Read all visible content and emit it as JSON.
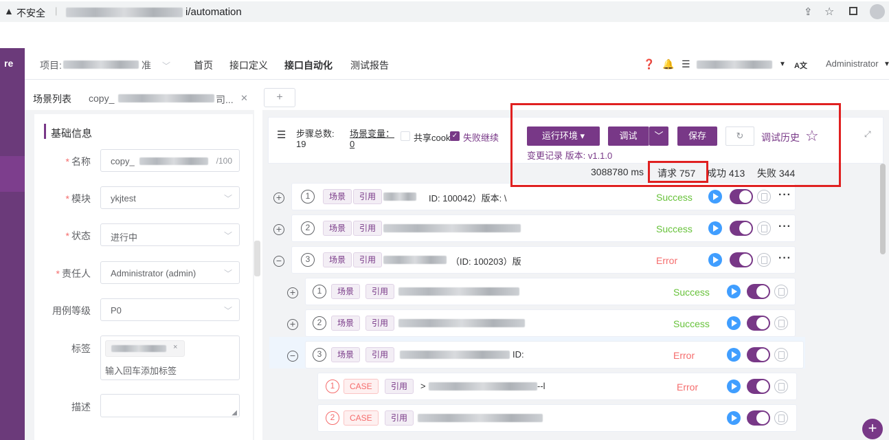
{
  "browser": {
    "security_label": "不安全",
    "url_suffix": "i/automation"
  },
  "app": {
    "brand": "re",
    "project_label": "项目:",
    "project_suffix": "准",
    "nav": [
      "首页",
      "接口定义",
      "接口自动化",
      "测试报告"
    ],
    "user": "Administrator",
    "lang_icon": "A文"
  },
  "tabs": {
    "scene_list": "场景列表",
    "current_tab": "copy_",
    "current_tab_suffix": "司...",
    "add": "+"
  },
  "form": {
    "section_title": "基础信息",
    "name_label": "名称",
    "name_value": "copy_",
    "name_counter": "/100",
    "module_label": "模块",
    "module_value": "ykjtest",
    "status_label": "状态",
    "status_value": "进行中",
    "owner_label": "责任人",
    "owner_value": "Administrator (admin)",
    "level_label": "用例等级",
    "level_value": "P0",
    "tag_label": "标签",
    "tag_placeholder": "输入回车添加标签",
    "desc_label": "描述"
  },
  "toolbar": {
    "steps_label": "步骤总数:",
    "steps_value": "19",
    "vars_label": "场景变量：",
    "vars_value": "0",
    "share_cookie": "共享cook",
    "fail_continue": "失败继续",
    "env_button": "运行环境",
    "debug_button": "调试",
    "save_button": "保存",
    "history": "调试历史",
    "change_record": "变更记录 版本: v1.1.0",
    "duration": "3088780 ms",
    "requests": "请求 757",
    "success": "成功 413",
    "fail": "失败 344"
  },
  "steps": [
    {
      "num": "1",
      "type": "场景",
      "ref": "引用",
      "text": "ID: 100042）版本: \\",
      "status": "Success",
      "expand": "+"
    },
    {
      "num": "2",
      "type": "场景",
      "ref": "引用",
      "text": "",
      "status": "Success",
      "expand": "+"
    },
    {
      "num": "3",
      "type": "场景",
      "ref": "引用",
      "text": "（ID: 100203）版",
      "status": "Error",
      "expand": "−"
    },
    {
      "num": "1",
      "type": "场景",
      "ref": "引用",
      "text": "",
      "status": "Success",
      "expand": "+"
    },
    {
      "num": "2",
      "type": "场景",
      "ref": "引用",
      "text": "",
      "status": "Success",
      "expand": "+"
    },
    {
      "num": "3",
      "type": "场景",
      "ref": "引用",
      "text": "ID:",
      "status": "Error",
      "expand": "−"
    },
    {
      "num": "1",
      "type": "CASE",
      "ref": "引用",
      "text": ">",
      "tail": "--l",
      "status": "Error"
    },
    {
      "num": "2",
      "type": "CASE",
      "ref": "引用",
      "text": "",
      "status": ""
    }
  ],
  "fab": "+",
  "colors": {
    "brand": "#783887",
    "success": "#67c23a",
    "error": "#f56c6c",
    "play": "#409eff",
    "highlight": "#e02020"
  }
}
